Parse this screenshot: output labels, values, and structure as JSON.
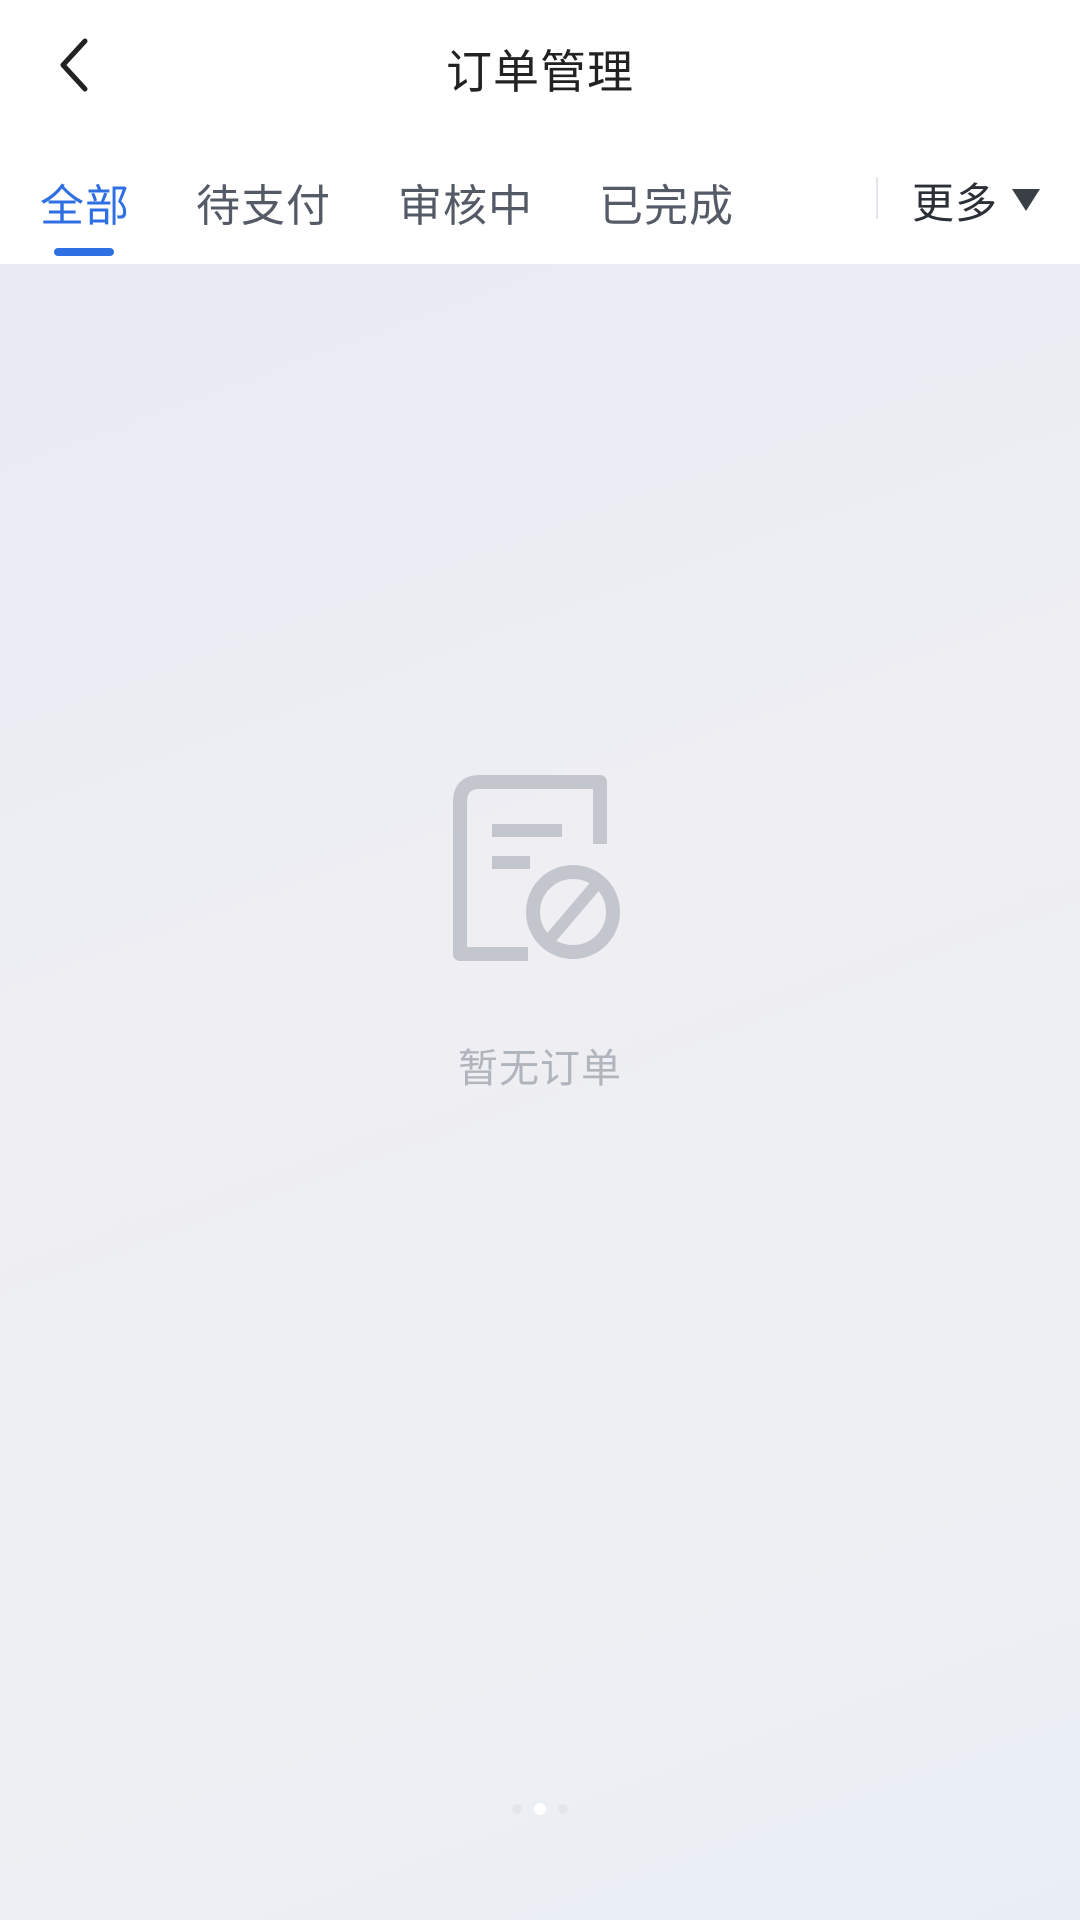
{
  "header": {
    "title": "订单管理",
    "back_icon": "chevron-left-icon"
  },
  "tabs": [
    {
      "label": "全部",
      "active": true
    },
    {
      "label": "待支付",
      "active": false
    },
    {
      "label": "审核中",
      "active": false
    },
    {
      "label": "已完成",
      "active": false
    }
  ],
  "more": {
    "label": "更多",
    "icon": "triangle-down-icon"
  },
  "empty_state": {
    "icon": "no-orders-document-icon",
    "text": "暂无订单"
  },
  "pagination": {
    "dot_count": 3,
    "active_index": 1
  },
  "colors": {
    "accent": "#2f6fe4",
    "tab_inactive": "#555b66",
    "empty_text": "#b0b4bc",
    "empty_icon": "#c3c6cd"
  }
}
